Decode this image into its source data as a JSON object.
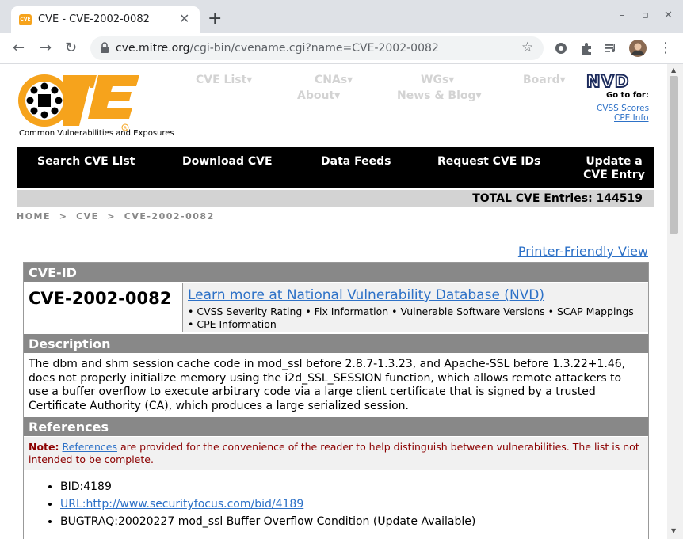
{
  "browser": {
    "tab_title": "CVE - CVE-2002-0082",
    "tab_favicon": "CVE",
    "url_host": "cve.mitre.org",
    "url_path": "/cgi-bin/cvename.cgi?name=CVE-2002-0082"
  },
  "header": {
    "logo_text": "CVE",
    "logo_tagline": "Common Vulnerabilities and Exposures",
    "nav": [
      "CVE List▾",
      "CNAs▾",
      "WGs▾",
      "Board▾",
      "About▾",
      "News & Blog▾"
    ],
    "nvd_logo": "NVD",
    "nvd_goto": "Go to for:",
    "nvd_links": [
      "CVSS Scores",
      "CPE Info"
    ]
  },
  "navbar": [
    "Search CVE List",
    "Download CVE",
    "Data Feeds",
    "Request CVE IDs",
    "Update a CVE Entry"
  ],
  "total": {
    "label": "TOTAL CVE Entries:",
    "count": "144519"
  },
  "breadcrumb": [
    "HOME",
    ">",
    "CVE",
    ">",
    "CVE-2002-0082"
  ],
  "printer_friendly": "Printer-Friendly View",
  "cve": {
    "id_header": "CVE-ID",
    "id": "CVE-2002-0082",
    "nvd_link": "Learn more at National Vulnerability Database (NVD)",
    "nvd_bullets": "• CVSS Severity Rating • Fix Information • Vulnerable Software Versions • SCAP Mappings • CPE Information",
    "description_header": "Description",
    "description": "The dbm and shm session cache code in mod_ssl before 2.8.7-1.3.23, and Apache-SSL before 1.3.22+1.46, does not properly initialize memory using the i2d_SSL_SESSION function, which allows remote attackers to use a buffer overflow to execute arbitrary code via a large client certificate that is signed by a trusted Certificate Authority (CA), which produces a large serialized session.",
    "references_header": "References",
    "note_label": "Note:",
    "note_link": "References",
    "note_text": " are provided for the convenience of the reader to help distinguish between vulnerabilities. The list is not intended to be complete.",
    "references": [
      {
        "text": "BID:4189",
        "is_link": false
      },
      {
        "text": "URL:http://www.securityfocus.com/bid/4189",
        "is_link": true
      },
      {
        "text": "BUGTRAQ:20020227 mod_ssl Buffer Overflow Condition (Update Available)",
        "is_link": false
      }
    ]
  },
  "colors": {
    "accent": "#f6a31c",
    "nav_bg": "#000000",
    "header_grey": "#888888",
    "note_red": "#8b0000",
    "link": "#2d71c7"
  }
}
